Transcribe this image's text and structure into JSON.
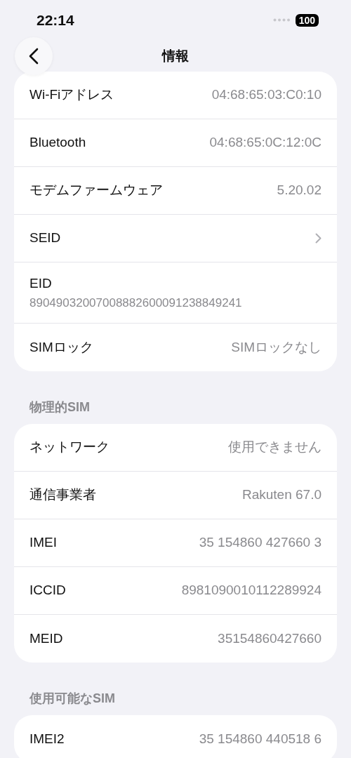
{
  "status_bar": {
    "time": "22:14",
    "battery": "100"
  },
  "nav": {
    "title": "情報"
  },
  "sections": [
    {
      "rows": [
        {
          "kind": "value",
          "label": "Wi-Fiアドレス",
          "value": "04:68:65:03:C0:10"
        },
        {
          "kind": "value",
          "label": "Bluetooth",
          "value": "04:68:65:0C:12:0C"
        },
        {
          "kind": "value",
          "label": "モデムファームウェア",
          "value": "5.20.02"
        },
        {
          "kind": "link",
          "label": "SEID"
        },
        {
          "kind": "stacked",
          "label": "EID",
          "value": "89049032007008882600091238849241"
        },
        {
          "kind": "value",
          "label": "SIMロック",
          "value": "SIMロックなし"
        }
      ]
    },
    {
      "header": "物理的SIM",
      "rows": [
        {
          "kind": "value",
          "label": "ネットワーク",
          "value": "使用できません"
        },
        {
          "kind": "value",
          "label": "通信事業者",
          "value": "Rakuten 67.0"
        },
        {
          "kind": "value",
          "label": "IMEI",
          "value": "35 154860 427660 3"
        },
        {
          "kind": "value",
          "label": "ICCID",
          "value": "8981090010112289924"
        },
        {
          "kind": "value",
          "label": "MEID",
          "value": "35154860427660"
        }
      ]
    },
    {
      "header": "使用可能なSIM",
      "rows": [
        {
          "kind": "value",
          "label": "IMEI2",
          "value": "35 154860 440518 6"
        }
      ]
    }
  ]
}
